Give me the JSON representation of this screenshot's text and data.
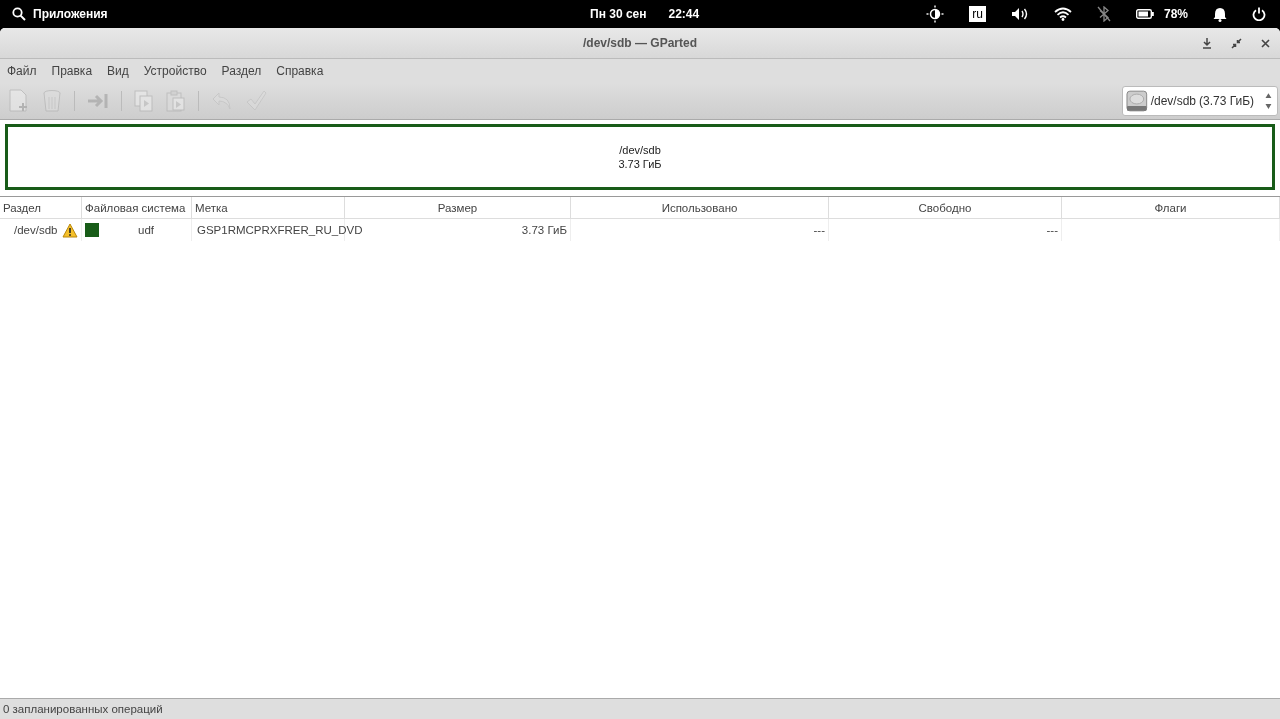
{
  "top_bar": {
    "apps_label": "Приложения",
    "date": "Пн 30 сен",
    "time": "22:44",
    "keyboard_layout": "ru",
    "battery": "78%"
  },
  "window": {
    "title": "/dev/sdb — GParted"
  },
  "menu": [
    "Файл",
    "Правка",
    "Вид",
    "Устройство",
    "Раздел",
    "Справка"
  ],
  "toolbar": [
    {
      "kind": "new",
      "disabled": true
    },
    {
      "kind": "delete",
      "disabled": true
    },
    {
      "kind": "sep"
    },
    {
      "kind": "resize",
      "disabled": true
    },
    {
      "kind": "sep"
    },
    {
      "kind": "copy",
      "disabled": true
    },
    {
      "kind": "paste",
      "disabled": true
    },
    {
      "kind": "sep"
    },
    {
      "kind": "undo",
      "disabled": true
    },
    {
      "kind": "apply",
      "disabled": true
    }
  ],
  "device_selector": {
    "device": "/dev/sdb",
    "size": "(3.73 ГиБ)"
  },
  "disk_map": {
    "device": "/dev/sdb",
    "size": "3.73 ГиБ"
  },
  "table": {
    "columns": [
      "Раздел",
      "Файловая система",
      "Метка",
      "Размер",
      "Использовано",
      "Свободно",
      "Флаги"
    ],
    "rows": [
      {
        "partition": "/dev/sdb",
        "warning": true,
        "color": "#185c18",
        "filesystem": "udf",
        "label": "GSP1RMCPRXFRER_RU_DVD",
        "size": "3.73 ГиБ",
        "used": "---",
        "free": "---"
      }
    ]
  },
  "status_bar": "0 запланированных операций"
}
